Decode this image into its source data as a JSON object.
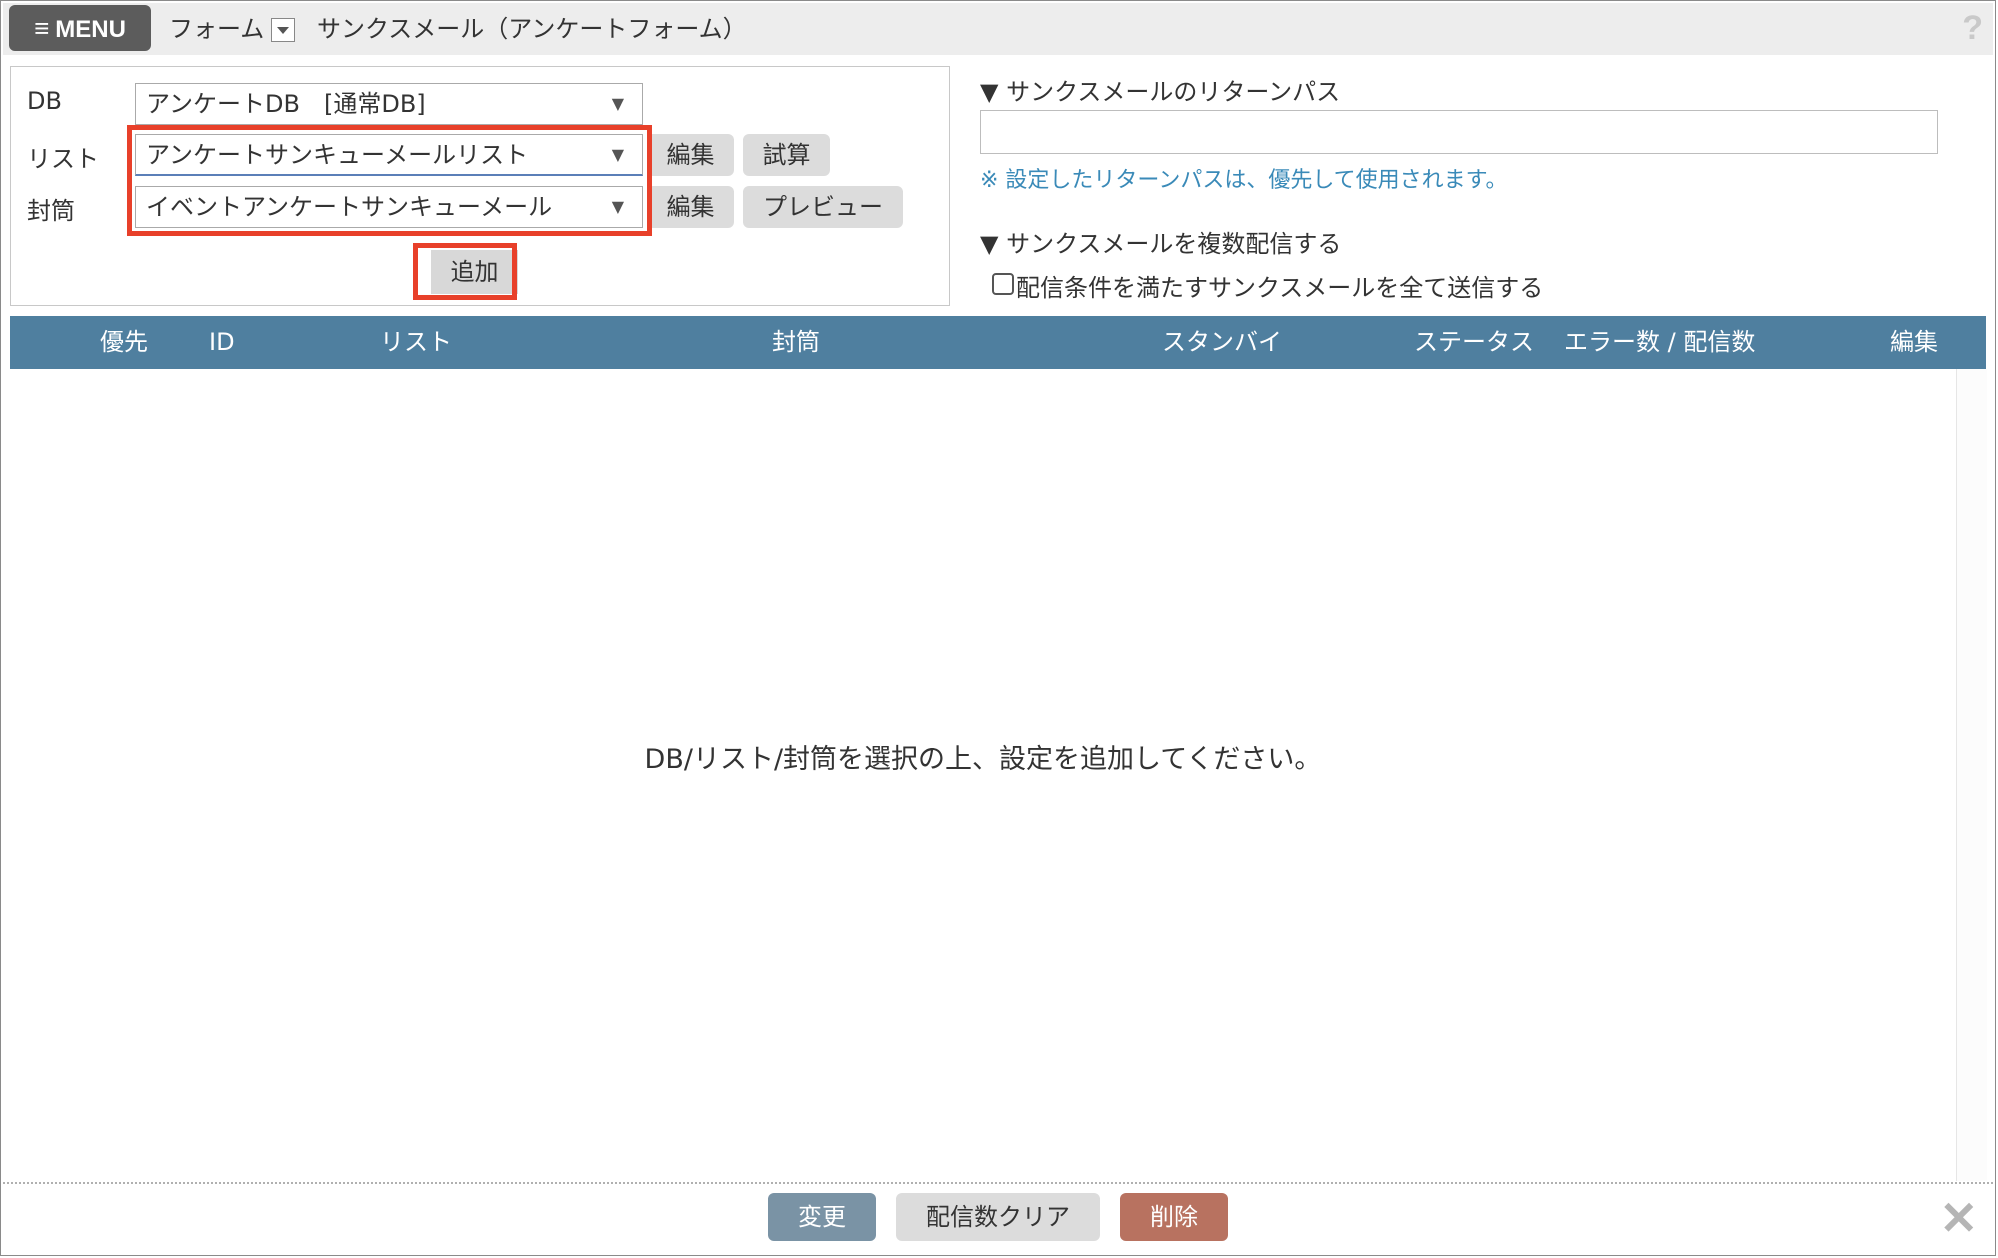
{
  "topbar": {
    "menu_label": "MENU",
    "crumb_form": "フォーム",
    "crumb_title": "サンクスメール（アンケートフォーム）",
    "help": "?"
  },
  "form": {
    "db_label": "DB",
    "db_value": "アンケートDB　[通常DB]",
    "list_label": "リスト",
    "list_value": "アンケートサンキューメールリスト",
    "envelope_label": "封筒",
    "envelope_value": "イベントアンケートサンキューメール",
    "edit_label": "編集",
    "trial_label": "試算",
    "preview_label": "プレビュー",
    "add_label": "追加",
    "arrow": "▼"
  },
  "right": {
    "return_path_heading": "▼ サンクスメールのリターンパス",
    "return_path_value": "",
    "return_path_note": "※ 設定したリターンパスは、優先して使用されます。",
    "multi_heading": "▼ サンクスメールを複数配信する",
    "multi_checkbox_label": "配信条件を満たすサンクスメールを全て送信する",
    "multi_checked": false
  },
  "table": {
    "columns": [
      "優先",
      "ID",
      "リスト",
      "封筒",
      "スタンバイ",
      "ステータス",
      "エラー数 / 配信数",
      "編集"
    ],
    "header_color": "#4f7f9f",
    "empty_message": "DB/リスト/封筒を選択の上、設定を追加してください。"
  },
  "footer": {
    "change_label": "変更",
    "clear_label": "配信数クリア",
    "delete_label": "削除",
    "close": "✕"
  },
  "colors": {
    "highlight": "#e8402a",
    "change_button": "#7a93a5",
    "delete_button": "#b87260",
    "note": "#3a8ab8"
  }
}
